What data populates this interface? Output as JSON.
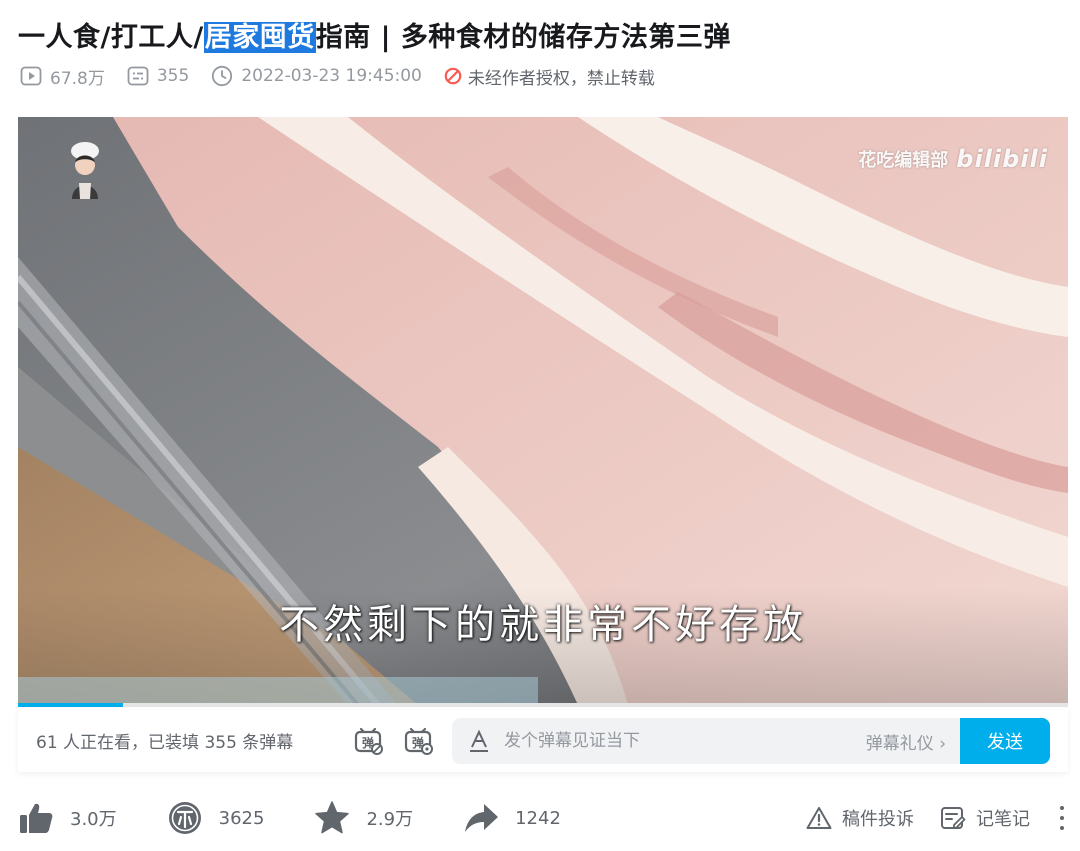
{
  "video": {
    "title_before": "一人食/打工人/",
    "title_highlight": "居家囤货",
    "title_after": "指南 | 多种食材的储存方法第三弹"
  },
  "meta": {
    "views": "67.8万",
    "danmaku_count": "355",
    "publish_time": "2022-03-23 19:45:00",
    "copyright_notice": "未经作者授权，禁止转载"
  },
  "player": {
    "subtitle": "不然剩下的就非常不好存放",
    "watermark_channel": "花吃编辑部",
    "watermark_brand": "bilibili",
    "progress": 0.1
  },
  "danmaku_bar": {
    "viewers_text": "61 人正在看，已装填 355 条弹幕",
    "input_placeholder": "发个弹幕见证当下",
    "etiquette_label": "弹幕礼仪 ›",
    "send_label": "发送"
  },
  "actions": {
    "like_count": "3.0万",
    "coin_count": "3625",
    "favorite_count": "2.9万",
    "share_count": "1242",
    "report_label": "稿件投诉",
    "notes_label": "记笔记"
  },
  "colors": {
    "accent": "#00aeec",
    "highlight": "#1f7ae0",
    "icon_gray": "#61666d",
    "warn_red": "#f85a54"
  }
}
